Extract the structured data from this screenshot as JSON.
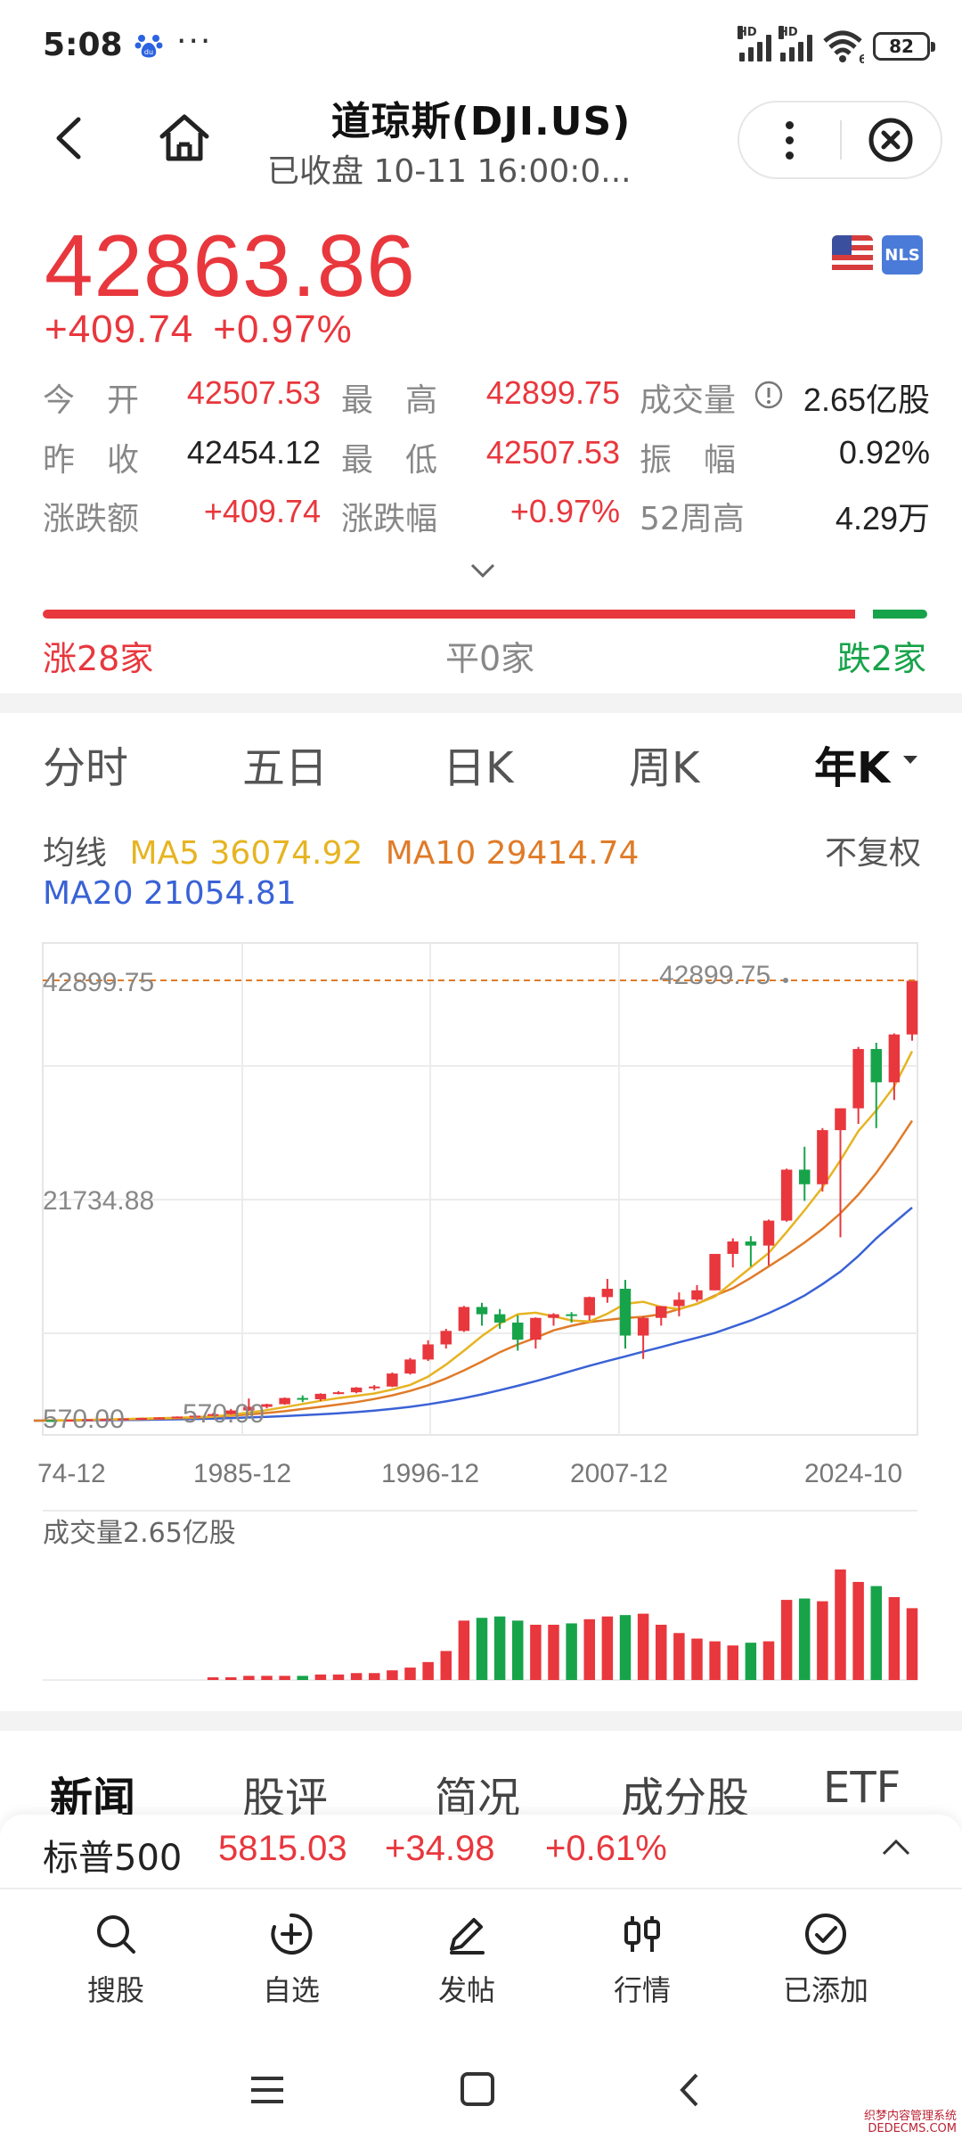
{
  "status_bar": {
    "time": "5:08",
    "more": "···",
    "battery": "82",
    "signal_labels": [
      "HD",
      "HD"
    ],
    "wifi_badge": "6"
  },
  "header": {
    "title": "道琼斯(DJI.US)",
    "subtitle": "已收盘 10-11 16:00:0..."
  },
  "quote": {
    "price": "42863.86",
    "change": "+409.74",
    "change_pct": "+0.97%",
    "badge": "NLS",
    "stats": [
      {
        "label": "今　开",
        "value": "42507.53",
        "color": "red"
      },
      {
        "label": "最　高",
        "value": "42899.75",
        "color": "red"
      },
      {
        "label": "成交量",
        "value": "2.65亿股",
        "color": "dark"
      },
      {
        "label": "昨　收",
        "value": "42454.12",
        "color": "dark"
      },
      {
        "label": "最　低",
        "value": "42507.53",
        "color": "red"
      },
      {
        "label": "振　幅",
        "value": "0.92%",
        "color": "dark"
      },
      {
        "label": "涨跌额",
        "value": "+409.74",
        "color": "red"
      },
      {
        "label": "涨跌幅",
        "value": "+0.97%",
        "color": "red"
      },
      {
        "label": "52周高",
        "value": "4.29万",
        "color": "dark"
      }
    ]
  },
  "breadth": {
    "up": "涨28家",
    "flat": "平0家",
    "down": "跌2家",
    "up_count": 28,
    "down_count": 2
  },
  "kline_tabs": [
    "分时",
    "五日",
    "日K",
    "周K",
    "年K"
  ],
  "active_tab": "年K",
  "ma": {
    "label": "均线",
    "ma5": "MA5 36074.92",
    "ma10": "MA10 29414.74",
    "ma20": "MA20 21054.81",
    "adjust": "不复权",
    "colors": {
      "ma5": "#e6b422",
      "ma10": "#e07b28",
      "ma20": "#3a62d6"
    }
  },
  "chart_labels": {
    "high_left": "42899.75",
    "high_right": "42899.75",
    "mid": "21734.88",
    "low_left": "570.00",
    "low_right": "570.00",
    "volume_label": "成交量2.65亿股"
  },
  "chart_data": {
    "type": "candlestick",
    "ylim": [
      570,
      42899.75
    ],
    "x_ticks": [
      "74-12",
      "1985-12",
      "1996-12",
      "2007-12",
      "2024-10"
    ],
    "colors": {
      "up": "#e8373d",
      "down": "#17a34a"
    },
    "candles": [
      {
        "o": 620,
        "c": 600,
        "h": 640,
        "l": 580,
        "v": 0
      },
      {
        "o": 600,
        "c": 650,
        "h": 660,
        "l": 590,
        "v": 0
      },
      {
        "o": 650,
        "c": 700,
        "h": 720,
        "l": 630,
        "v": 0
      },
      {
        "o": 700,
        "c": 730,
        "h": 760,
        "l": 680,
        "v": 0
      },
      {
        "o": 730,
        "c": 780,
        "h": 800,
        "l": 720,
        "v": 0
      },
      {
        "o": 780,
        "c": 830,
        "h": 850,
        "l": 760,
        "v": 0
      },
      {
        "o": 830,
        "c": 880,
        "h": 900,
        "l": 810,
        "v": 0
      },
      {
        "o": 880,
        "c": 960,
        "h": 980,
        "l": 870,
        "v": 0
      },
      {
        "o": 960,
        "c": 1050,
        "h": 1080,
        "l": 940,
        "v": 0
      },
      {
        "o": 1050,
        "c": 1200,
        "h": 1300,
        "l": 1000,
        "v": 1
      },
      {
        "o": 1200,
        "c": 1550,
        "h": 1700,
        "l": 1150,
        "v": 2
      },
      {
        "o": 1550,
        "c": 1900,
        "h": 2700,
        "l": 1500,
        "v": 3
      },
      {
        "o": 1900,
        "c": 2150,
        "h": 2200,
        "l": 1750,
        "v": 3
      },
      {
        "o": 2150,
        "c": 2750,
        "h": 2800,
        "l": 2100,
        "v": 3
      },
      {
        "o": 2750,
        "c": 2630,
        "h": 3000,
        "l": 2350,
        "v": 3
      },
      {
        "o": 2630,
        "c": 3150,
        "h": 3200,
        "l": 2450,
        "v": 4
      },
      {
        "o": 3150,
        "c": 3300,
        "h": 3400,
        "l": 3100,
        "v": 4
      },
      {
        "o": 3300,
        "c": 3750,
        "h": 3800,
        "l": 3200,
        "v": 5
      },
      {
        "o": 3750,
        "c": 3850,
        "h": 4000,
        "l": 3500,
        "v": 5
      },
      {
        "o": 3850,
        "c": 5100,
        "h": 5200,
        "l": 3800,
        "v": 7
      },
      {
        "o": 5100,
        "c": 6450,
        "h": 6600,
        "l": 5000,
        "v": 9
      },
      {
        "o": 6450,
        "c": 7900,
        "h": 8300,
        "l": 6300,
        "v": 13
      },
      {
        "o": 7900,
        "c": 9200,
        "h": 9400,
        "l": 7500,
        "v": 21
      },
      {
        "o": 9200,
        "c": 11500,
        "h": 11600,
        "l": 9100,
        "v": 43
      },
      {
        "o": 11500,
        "c": 10800,
        "h": 11900,
        "l": 9700,
        "v": 45
      },
      {
        "o": 10800,
        "c": 10000,
        "h": 11300,
        "l": 9400,
        "v": 46
      },
      {
        "o": 10000,
        "c": 8350,
        "h": 10700,
        "l": 7300,
        "v": 43
      },
      {
        "o": 8350,
        "c": 10450,
        "h": 10500,
        "l": 7500,
        "v": 40
      },
      {
        "o": 10450,
        "c": 10800,
        "h": 10900,
        "l": 9700,
        "v": 40
      },
      {
        "o": 10800,
        "c": 10700,
        "h": 11000,
        "l": 10000,
        "v": 41
      },
      {
        "o": 10700,
        "c": 12450,
        "h": 12500,
        "l": 10200,
        "v": 44
      },
      {
        "o": 12450,
        "c": 13250,
        "h": 14200,
        "l": 11900,
        "v": 46
      },
      {
        "o": 13250,
        "c": 8750,
        "h": 14100,
        "l": 7500,
        "v": 47
      },
      {
        "o": 8750,
        "c": 10450,
        "h": 10600,
        "l": 6500,
        "v": 48
      },
      {
        "o": 10450,
        "c": 11580,
        "h": 11600,
        "l": 9700,
        "v": 40
      },
      {
        "o": 11580,
        "c": 12200,
        "h": 12900,
        "l": 10600,
        "v": 34
      },
      {
        "o": 12200,
        "c": 13100,
        "h": 13600,
        "l": 12000,
        "v": 30
      },
      {
        "o": 13100,
        "c": 16600,
        "h": 16600,
        "l": 13100,
        "v": 28
      },
      {
        "o": 16600,
        "c": 17800,
        "h": 18100,
        "l": 15300,
        "v": 25
      },
      {
        "o": 17800,
        "c": 17400,
        "h": 18300,
        "l": 15400,
        "v": 27
      },
      {
        "o": 17400,
        "c": 19800,
        "h": 19900,
        "l": 15500,
        "v": 28
      },
      {
        "o": 19800,
        "c": 24700,
        "h": 24800,
        "l": 19700,
        "v": 58
      },
      {
        "o": 24700,
        "c": 23300,
        "h": 26900,
        "l": 21700,
        "v": 59
      },
      {
        "o": 23300,
        "c": 28500,
        "h": 28700,
        "l": 22600,
        "v": 57
      },
      {
        "o": 28500,
        "c": 30600,
        "h": 30600,
        "l": 18200,
        "v": 80
      },
      {
        "o": 30600,
        "c": 36300,
        "h": 36500,
        "l": 29100,
        "v": 71
      },
      {
        "o": 36300,
        "c": 33100,
        "h": 36900,
        "l": 28700,
        "v": 68
      },
      {
        "o": 33100,
        "c": 37700,
        "h": 37800,
        "l": 31400,
        "v": 60
      },
      {
        "o": 37700,
        "c": 42864,
        "h": 42900,
        "l": 37100,
        "v": 52
      }
    ],
    "ma5_series": [
      570,
      600,
      640,
      680,
      720,
      760,
      800,
      850,
      900,
      980,
      1130,
      1340,
      1580,
      1870,
      2170,
      2480,
      2740,
      2960,
      3180,
      3560,
      4010,
      4800,
      5960,
      7300,
      8700,
      9900,
      10800,
      10950,
      10600,
      10200,
      10100,
      10850,
      11800,
      12000,
      11500,
      11300,
      11800,
      12500,
      13900,
      15300,
      16700,
      18700,
      20800,
      23000,
      25600,
      28400,
      30400,
      32700,
      36074.92
    ],
    "ma10_series": [
      570,
      590,
      610,
      630,
      660,
      690,
      720,
      760,
      800,
      850,
      940,
      1050,
      1170,
      1310,
      1480,
      1690,
      1900,
      2120,
      2350,
      2650,
      3000,
      3430,
      3960,
      4620,
      5400,
      6250,
      7150,
      7900,
      8550,
      9250,
      9700,
      10050,
      10250,
      10450,
      10550,
      10800,
      11300,
      11800,
      12600,
      13300,
      14300,
      15400,
      16500,
      17700,
      19000,
      20500,
      22300,
      24400,
      26800,
      29414.74
    ],
    "ma20_series": [
      570,
      580,
      590,
      600,
      610,
      630,
      650,
      670,
      700,
      730,
      770,
      820,
      880,
      940,
      1010,
      1090,
      1180,
      1280,
      1390,
      1530,
      1700,
      1900,
      2140,
      2420,
      2740,
      3100,
      3500,
      3920,
      4370,
      4850,
      5350,
      5850,
      6300,
      6750,
      7200,
      7650,
      8100,
      8550,
      9000,
      9600,
      10200,
      10900,
      11700,
      12600,
      13700,
      14900,
      16400,
      18100,
      19600,
      21054.81
    ]
  },
  "news_tabs": [
    "新闻",
    "股评",
    "简况",
    "成分股",
    "ETF"
  ],
  "bottom_quote": {
    "name": "标普500",
    "price": "5815.03",
    "change": "+34.98",
    "change_pct": "+0.61%"
  },
  "bottom_nav": [
    {
      "label": "搜股",
      "icon": "search-icon"
    },
    {
      "label": "自选",
      "icon": "add-watch-icon"
    },
    {
      "label": "发帖",
      "icon": "pen-icon"
    },
    {
      "label": "行情",
      "icon": "candle-icon"
    },
    {
      "label": "已添加",
      "icon": "check-circle-icon"
    }
  ],
  "watermark": [
    "织梦内容管理系统",
    "DEDECMS.COM"
  ]
}
